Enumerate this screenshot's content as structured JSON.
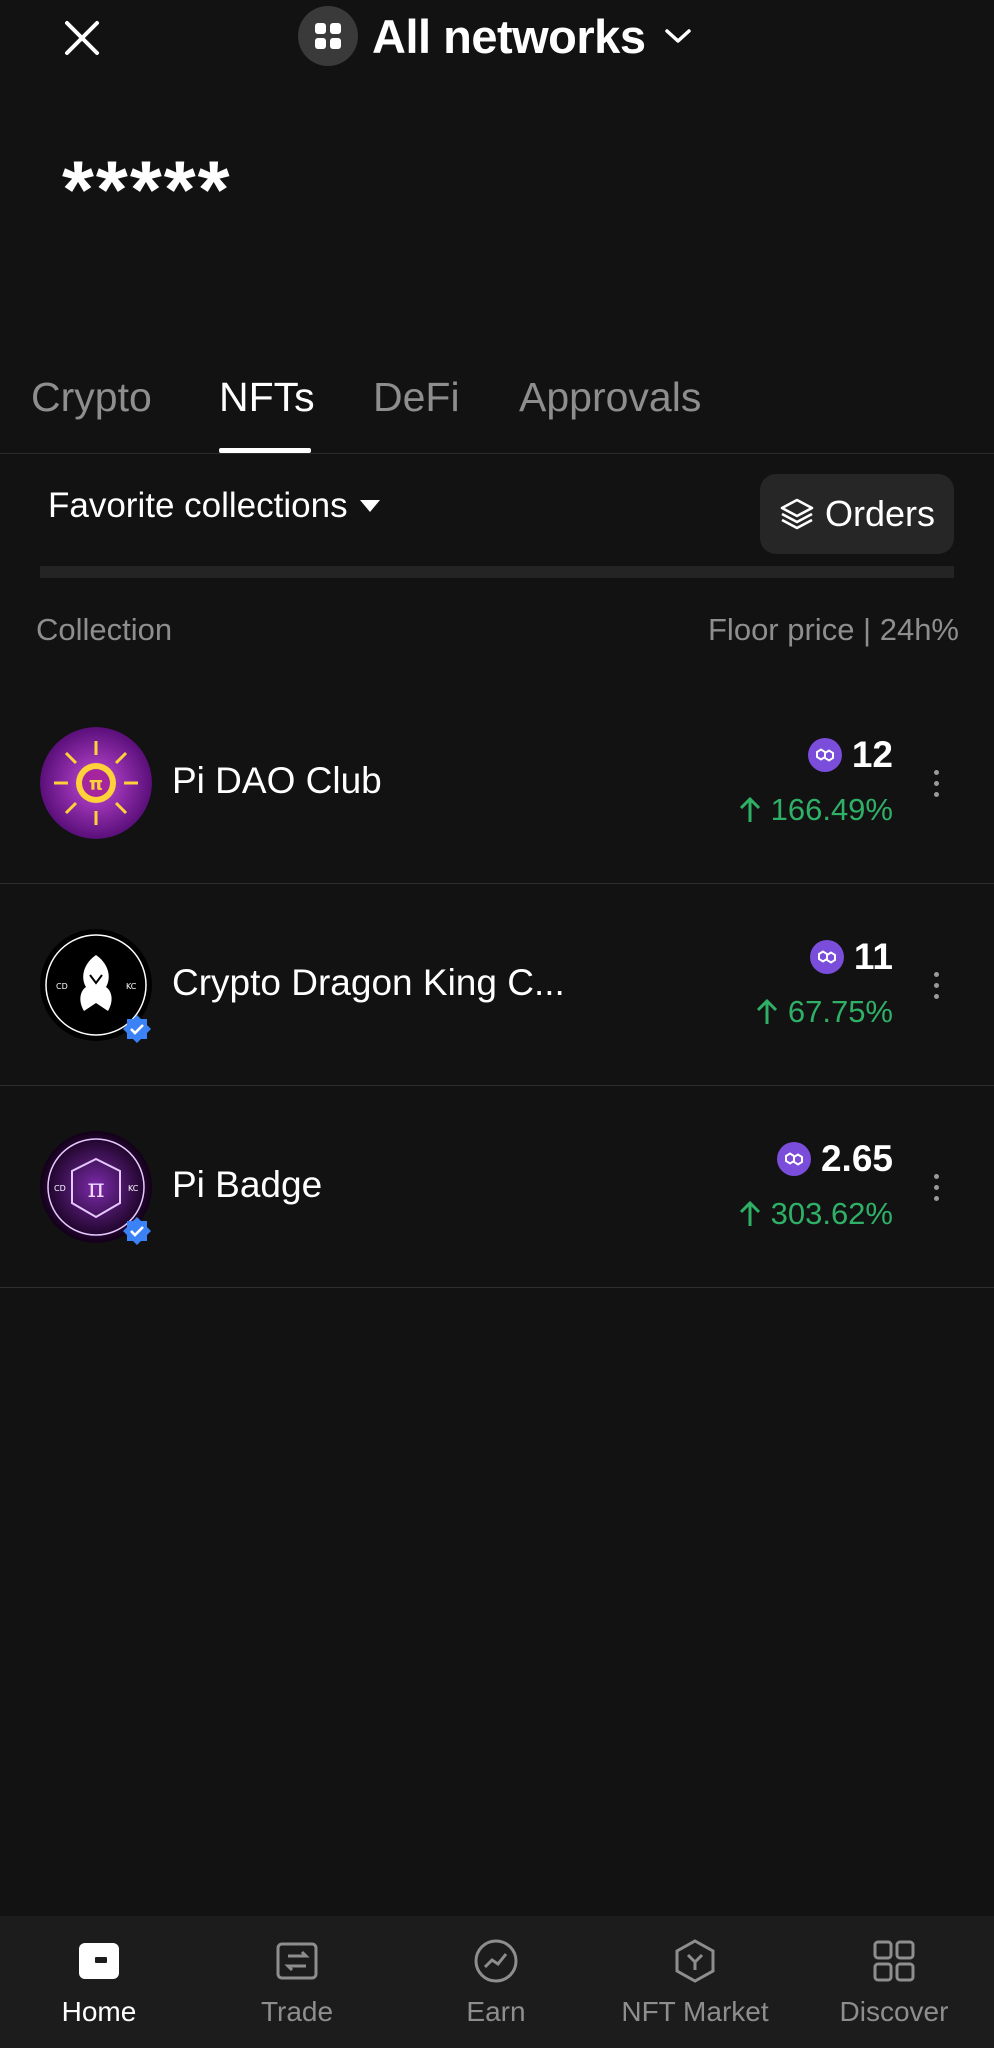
{
  "header": {
    "network_label": "All networks",
    "icons": {
      "close": "close-icon",
      "network": "apps-grid-icon",
      "dropdown": "chevron-down-icon"
    }
  },
  "balance": {
    "masked": "*****"
  },
  "tabs": [
    {
      "label": "Crypto",
      "active": false
    },
    {
      "label": "NFTs",
      "active": true
    },
    {
      "label": "DeFi",
      "active": false
    },
    {
      "label": "Approvals",
      "active": false
    }
  ],
  "filter": {
    "favorites_label": "Favorite collections",
    "orders_label": "Orders"
  },
  "list": {
    "col_collection": "Collection",
    "col_floor": "Floor price | 24h%",
    "rows": [
      {
        "name": "Pi DAO Club",
        "price": "12",
        "change": "166.49%",
        "verified": false,
        "chain_icon": "polygon-icon",
        "direction": "up"
      },
      {
        "name": "Crypto Dragon King C...",
        "price": "11",
        "change": "67.75%",
        "verified": true,
        "chain_icon": "polygon-icon",
        "direction": "up"
      },
      {
        "name": "Pi Badge",
        "price": "2.65",
        "change": "303.62%",
        "verified": true,
        "chain_icon": "polygon-icon",
        "direction": "up"
      }
    ]
  },
  "bottom_nav": [
    {
      "label": "Home",
      "icon": "wallet-icon",
      "active": true
    },
    {
      "label": "Trade",
      "icon": "trade-icon",
      "active": false
    },
    {
      "label": "Earn",
      "icon": "earn-icon",
      "active": false
    },
    {
      "label": "NFT Market",
      "icon": "nft-market-icon",
      "active": false
    },
    {
      "label": "Discover",
      "icon": "discover-grid-icon",
      "active": false
    }
  ],
  "colors": {
    "background": "#121212",
    "positive": "#2fb067",
    "polygon": "#7b4ddb",
    "verified": "#3b82f6"
  }
}
